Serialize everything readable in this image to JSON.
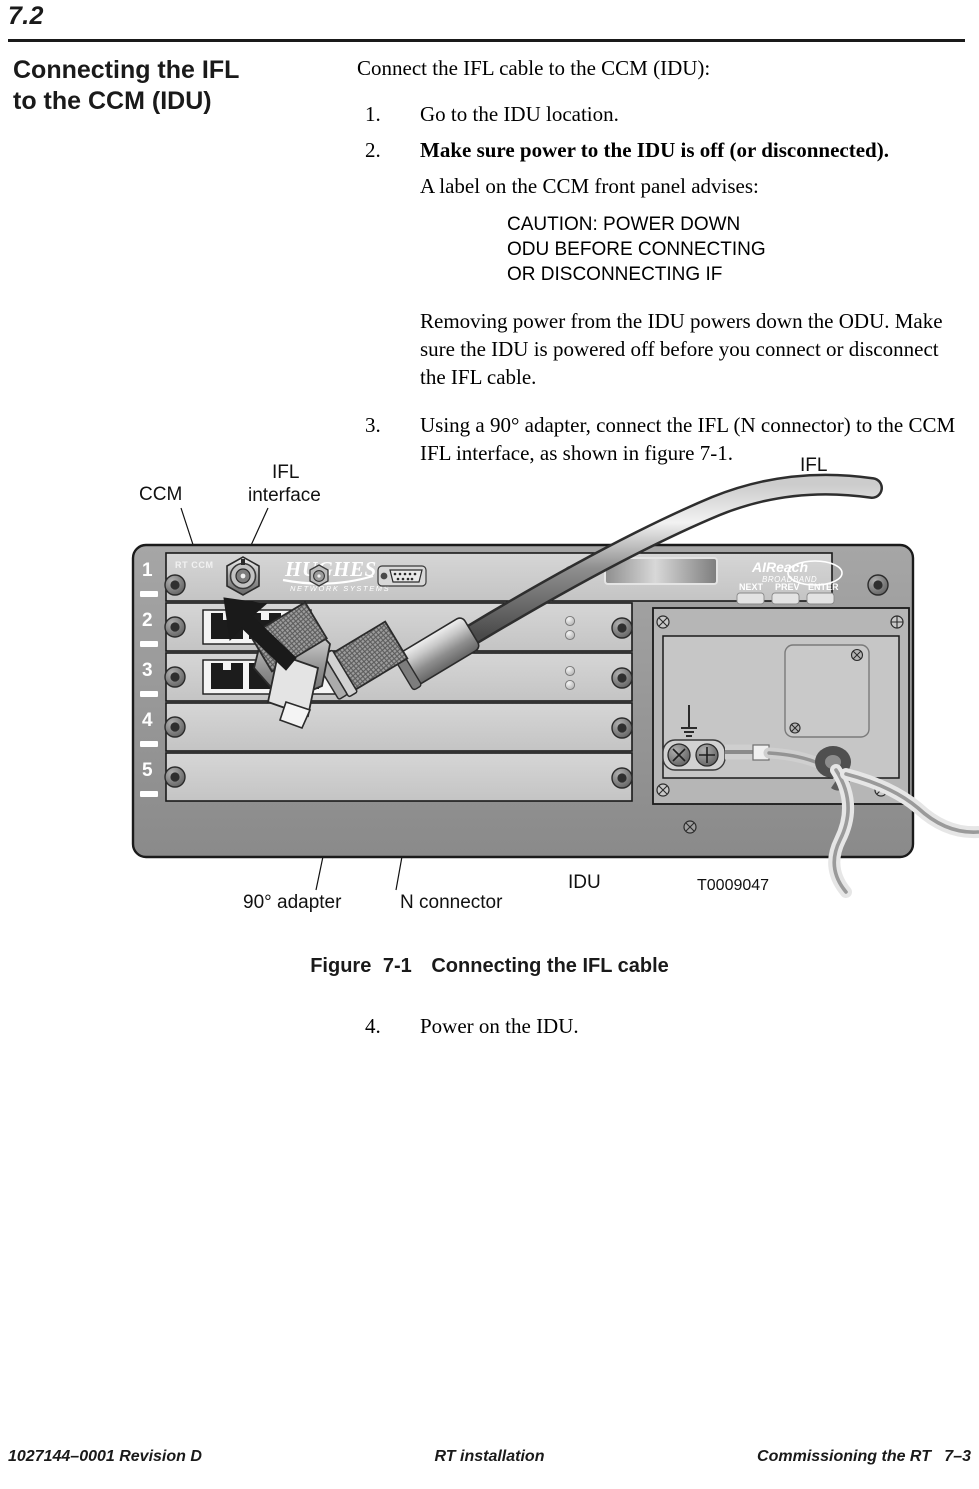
{
  "page": {
    "section_number": "7.2",
    "side_heading_line1": "Connecting the IFL",
    "side_heading_line2": "to the CCM (IDU)"
  },
  "body": {
    "lead": "Connect the IFL cable to the CCM (IDU):",
    "steps": [
      {
        "num": "1.",
        "text": "Go to the IDU location.",
        "bold": false
      },
      {
        "num": "2.",
        "text": "Make sure power to the IDU is off (or disconnected).",
        "bold": true
      }
    ],
    "sub_para_1": "A label on the CCM front panel advises:",
    "caution_lines": [
      "CAUTION: POWER DOWN",
      "ODU BEFORE CONNECTING",
      "OR DISCONNECTING IF"
    ],
    "sub_para_2": "Removing power from the IDU powers down the ODU. Make sure the IDU is powered off before you connect or disconnect the IFL cable.",
    "step3_num": "3.",
    "step3_text": "Using a 90° adapter, connect the IFL (N connector) to the CCM IFL interface, as shown in figure 7-1.",
    "step4_num": "4.",
    "step4_text": "Power on the IDU."
  },
  "figure": {
    "caption_label": "Figure",
    "caption_number": "7-1",
    "caption_title": "Connecting the IFL cable",
    "drawing_number": "T0009047",
    "callouts": {
      "ccm": "CCM",
      "ifl_interface_line1": "IFL",
      "ifl_interface_line2": "interface",
      "ifl_cable": "IFL",
      "adapter": "90° adapter",
      "n_connector": "N connector",
      "idu": "IDU"
    },
    "panel": {
      "card_label": "RT CCM",
      "brand_primary": "HUGHES",
      "brand_secondary": "NETWORK SYSTEMS",
      "brand_right_primary": "AIReach",
      "brand_right_secondary": "BROADBAND",
      "buttons": [
        "NEXT",
        "PREV",
        "ENTER"
      ],
      "slot_numbers": [
        "1",
        "2",
        "3",
        "4",
        "5"
      ]
    },
    "colors": {
      "chassis_frame": "#9a9a9a",
      "card_face": "#cfcfcf",
      "card_face_dark": "#b9b9b9",
      "outline": "#1a1a1a",
      "cable": "#8c8c8c",
      "metal": "#a8a8a8"
    }
  },
  "footer": {
    "left": "1027144–0001  Revision D",
    "center": "RT installation",
    "right": "Commissioning the RT   7–3"
  }
}
